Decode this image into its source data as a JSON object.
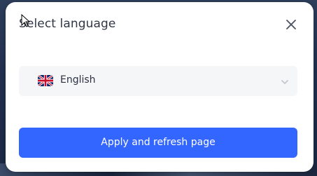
{
  "dialog": {
    "title": "Select language",
    "close_icon": "close-icon"
  },
  "language_select": {
    "selected_value": "English",
    "flag_icon": "uk-flag-icon",
    "chevron_icon": "chevron-down-icon"
  },
  "actions": {
    "apply_label": "Apply and refresh page"
  },
  "colors": {
    "primary": "#3366ff",
    "select_bg": "#f5f6f8",
    "text": "#2f3747",
    "backdrop": "#223150"
  }
}
